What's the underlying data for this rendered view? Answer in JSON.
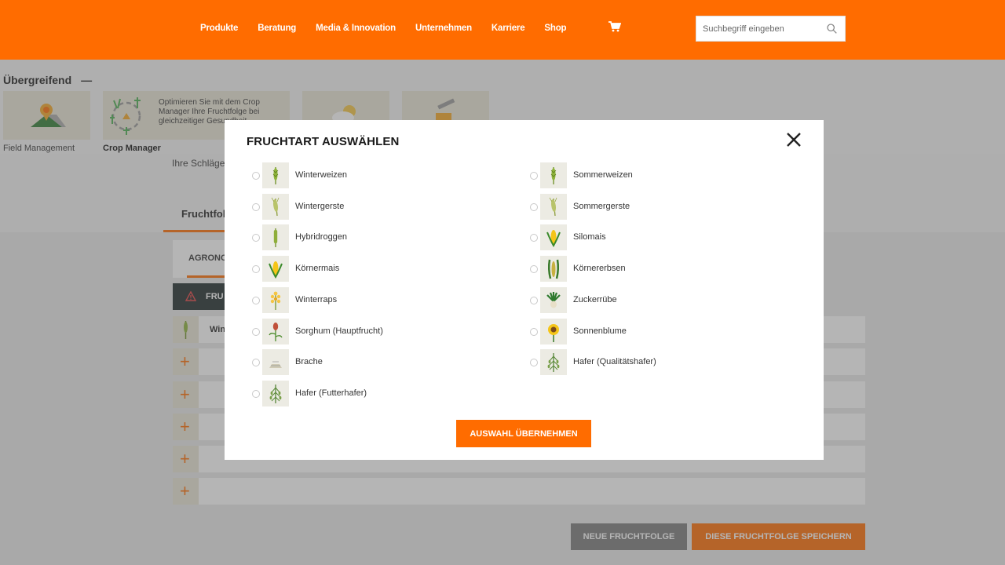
{
  "header": {
    "nav": [
      "Produkte",
      "Beratung",
      "Media & Innovation",
      "Unternehmen",
      "Karriere",
      "Shop"
    ],
    "search_placeholder": "Suchbegriff eingeben"
  },
  "page": {
    "section_title": "Übergreifend",
    "section_toggle": "—",
    "tiles": {
      "field_management": "Field Management",
      "crop_manager": "Crop Manager",
      "crop_manager_desc": "Optimieren Sie mit dem Crop Manager Ihre Fruchtfolge bei gleichzeitiger Gesundheit"
    },
    "schlage_text": "Ihre Schläge",
    "tab_label": "Fruchtfolg",
    "agro_tab": "AGRONO",
    "alert_label": "FRU",
    "first_row_text": "Win",
    "buttons": {
      "new": "NEUE FRUCHTFOLGE",
      "save": "DIESE FRUCHTFOLGE SPEICHERN"
    }
  },
  "modal": {
    "title": "FRUCHTART AUSWÄHLEN",
    "apply_label": "AUSWAHL ÜBERNEHMEN",
    "options_left": [
      {
        "label": "Winterweizen",
        "icon": "wheat-icon"
      },
      {
        "label": "Wintergerste",
        "icon": "barley-icon"
      },
      {
        "label": "Hybridroggen",
        "icon": "rye-icon"
      },
      {
        "label": "Körnermais",
        "icon": "corn-icon"
      },
      {
        "label": "Winterraps",
        "icon": "rapeseed-icon"
      },
      {
        "label": "Sorghum (Hauptfrucht)",
        "icon": "sorghum-icon"
      },
      {
        "label": "Brache",
        "icon": "fallow-icon"
      },
      {
        "label": "Hafer (Futterhafer)",
        "icon": "oat-icon"
      }
    ],
    "options_right": [
      {
        "label": "Sommerweizen",
        "icon": "wheat-icon"
      },
      {
        "label": "Sommergerste",
        "icon": "barley-icon"
      },
      {
        "label": "Silomais",
        "icon": "corn-icon"
      },
      {
        "label": "Körnererbsen",
        "icon": "pea-icon"
      },
      {
        "label": "Zuckerrübe",
        "icon": "sugarbeet-icon"
      },
      {
        "label": "Sonnenblume",
        "icon": "sunflower-icon"
      },
      {
        "label": "Hafer (Qualitätshafer)",
        "icon": "oat-icon"
      }
    ]
  },
  "colors": {
    "brand": "#ff6c00",
    "dark": "#1e2a2a"
  }
}
